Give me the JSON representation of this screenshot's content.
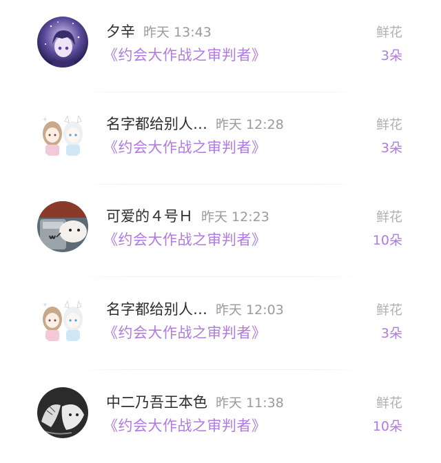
{
  "records": [
    {
      "name": "夕辛",
      "time": "昨天 13:43",
      "title": "《约会大作战之审判者》",
      "gift_label": "鲜花",
      "gift_count": "3朵",
      "avatar": "purple-anime-avatar"
    },
    {
      "name": "名字都给别人…",
      "time": "昨天 12:28",
      "title": "《约会大作战之审判者》",
      "gift_label": "鲜花",
      "gift_count": "3朵",
      "avatar": "two-anime-girls-avatar"
    },
    {
      "name": "可爱的４号Ｈ",
      "time": "昨天 12:23",
      "title": "《约会大作战之审判者》",
      "gift_label": "鲜花",
      "gift_count": "10朵",
      "avatar": "cartoon-meme-avatar"
    },
    {
      "name": "名字都给别人…",
      "time": "昨天 12:03",
      "title": "《约会大作战之审判者》",
      "gift_label": "鲜花",
      "gift_count": "3朵",
      "avatar": "two-anime-girls-avatar"
    },
    {
      "name": "中二乃吾王本色",
      "time": "昨天 11:38",
      "title": "《约会大作战之审判者》",
      "gift_label": "鲜花",
      "gift_count": "10朵",
      "avatar": "sketch-anime-avatar"
    }
  ],
  "colors": {
    "accent": "#b07ae0",
    "name": "#2c2c2c",
    "muted": "#9a9a9a"
  }
}
